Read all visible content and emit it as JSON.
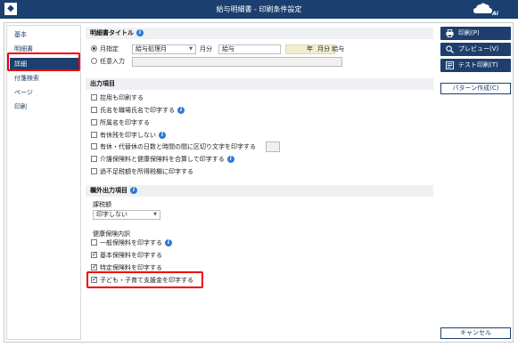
{
  "window": {
    "title": "給与明細書 - 印刷条件設定",
    "logo_text": "AI"
  },
  "sidebar": {
    "items": [
      {
        "label": "基本"
      },
      {
        "label": "明細書"
      },
      {
        "label": "詳細",
        "active": true
      },
      {
        "label": "付箋検索"
      },
      {
        "label": "ページ"
      },
      {
        "label": "印刷"
      }
    ]
  },
  "title_section": {
    "heading": "明細書タイトル",
    "option_fixed": "月指定",
    "option_free": "任意入力",
    "select_value": "給与処理月",
    "month_label": "月分",
    "title_value": "給与",
    "preview_year": "年",
    "preview_month": "月分 給与"
  },
  "output_section": {
    "heading": "出力項目",
    "items": [
      {
        "label": "控用も印刷する",
        "checked": false,
        "info": false
      },
      {
        "label": "氏名を職場氏名で印字する",
        "checked": false,
        "info": true
      },
      {
        "label": "所属名を印字する",
        "checked": false,
        "info": false
      },
      {
        "label": "有休残を印字しない",
        "checked": false,
        "info": true
      },
      {
        "label": "有休・代替休の日数と時間の間に区切り文字を印字する",
        "checked": false,
        "info": false
      },
      {
        "label": "介護保険料と健康保険料を合算して印字する",
        "checked": false,
        "info": true
      },
      {
        "label": "過不足税額を所得税欄に印字する",
        "checked": false,
        "info": false
      }
    ]
  },
  "extra_section": {
    "heading": "欄外出力項目",
    "tax_label": "課税額",
    "tax_select": "印字しない",
    "health_label": "健康保険内訳",
    "items": [
      {
        "label": "一般保険料を印字する",
        "checked": false,
        "info": true
      },
      {
        "label": "基本保険料を印字する",
        "checked": true,
        "info": false
      },
      {
        "label": "特定保険料を印字する",
        "checked": true,
        "info": false
      },
      {
        "label": "子ども・子育て支援金を印字する",
        "checked": true,
        "info": false
      }
    ]
  },
  "actions": {
    "print": "印刷(P)",
    "preview": "プレビュー(V)",
    "test_print": "テスト印刷(T)",
    "pattern": "パターン作成(C)",
    "cancel": "キャンセル"
  },
  "colors": {
    "primary": "#1e3f6d",
    "info": "#2a7bd2",
    "highlight": "#e00000",
    "titlebar": "#1b3f6e"
  }
}
